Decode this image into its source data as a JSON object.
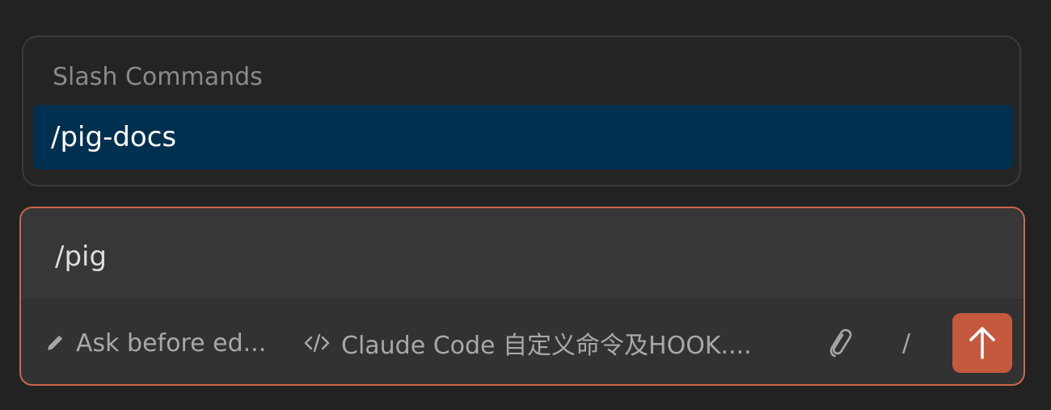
{
  "slash_commands": {
    "header": "Slash Commands",
    "items": [
      {
        "label": "/pig-docs",
        "selected": true
      }
    ]
  },
  "composer": {
    "input_value": "/pig",
    "toolbar": {
      "mode_label": "Ask before ed...",
      "mode_icon": "pencil-icon",
      "context_label": "Claude Code 自定义命令及HOOK....",
      "context_icon": "code-icon",
      "attach_icon": "paperclip-icon",
      "slash_label": "/",
      "send_icon": "arrow-up-icon"
    }
  },
  "colors": {
    "background": "#222222",
    "selected_item": "#00304f",
    "composer_border": "#c9674c",
    "send_button": "#c4593d"
  }
}
